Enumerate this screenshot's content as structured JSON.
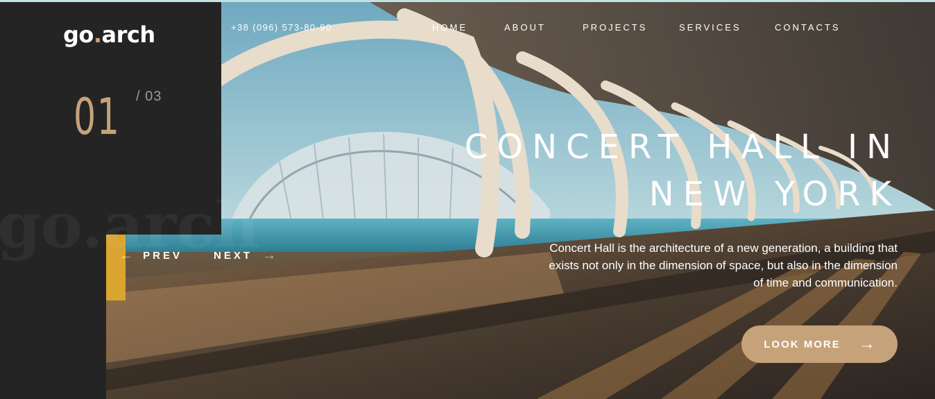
{
  "brand": {
    "name_part1": "go",
    "dot": ".",
    "name_part2": "arch",
    "watermark": "go.arch"
  },
  "header": {
    "phone": "+38 (096) 573-80-90",
    "nav": [
      {
        "label": "HOME"
      },
      {
        "label": "ABOUT"
      },
      {
        "label": "PROJECTS"
      },
      {
        "label": "SERVICES"
      },
      {
        "label": "CONTACTS"
      }
    ]
  },
  "slider": {
    "current": "01",
    "total": "/ 03",
    "prev_label": "PREV",
    "next_label": "NEXT",
    "prev_icon": "arrow-left-icon",
    "next_icon": "arrow-right-icon"
  },
  "hero": {
    "title": "CONCERT HALL IN NEW YORK",
    "description": "Concert Hall is the architecture of a new generation, a building that exists not only in the dimension of space, but also in the dimension of time and communication.",
    "cta_label": "LOOK MORE",
    "cta_icon": "arrow-right-icon"
  },
  "colors": {
    "accent": "#c6a27a",
    "panel": "#242424",
    "text": "#ffffff"
  }
}
